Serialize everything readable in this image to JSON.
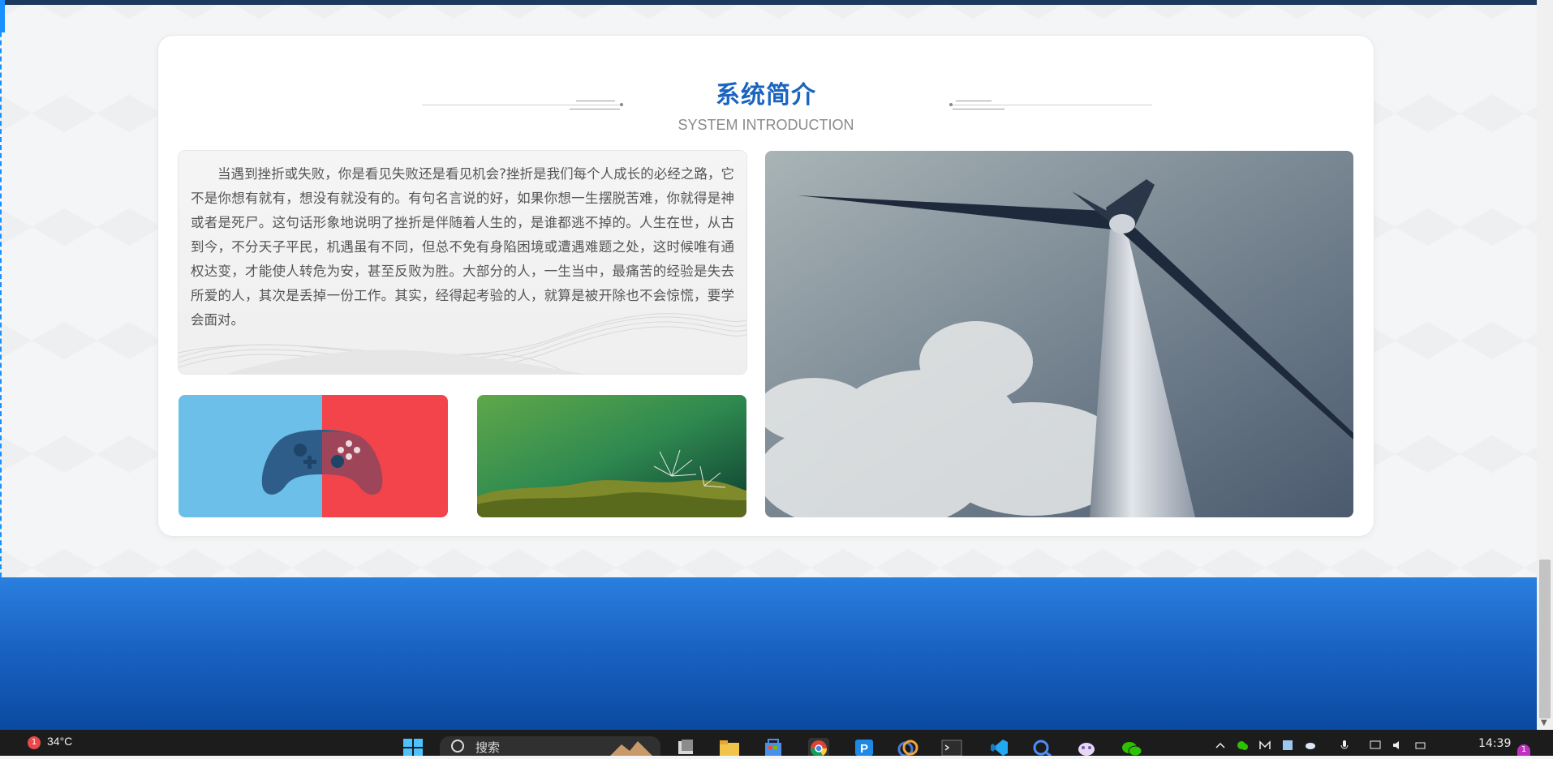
{
  "section": {
    "title": "系统简介",
    "subtitle": "SYSTEM INTRODUCTION"
  },
  "intro": {
    "text": "当遇到挫折或失败，你是看见失败还是看见机会?挫折是我们每个人成长的必经之路，它不是你想有就有，想没有就没有的。有句名言说的好，如果你想一生摆脱苦难，你就得是神或者是死尸。这句话形象地说明了挫折是伴随着人生的，是谁都逃不掉的。人生在世，从古到今，不分天子平民，机遇虽有不同，但总不免有身陷困境或遭遇难题之处，这时候唯有通权达变，才能使人转危为安，甚至反败为胜。大部分的人，一生当中，最痛苦的经验是失去所爱的人，其次是丢掉一份工作。其实，经得起考验的人，就算是被开除也不会惊慌，要学会面对。"
  },
  "images": {
    "gamepad": "gamepad-icon",
    "moss": "moss-dandelion-photo",
    "turbine": "wind-turbine-photo"
  },
  "taskbar": {
    "weather_temp": "34°C",
    "weather_badge": "1",
    "search_label": "搜索",
    "clock": "14:39",
    "notification_badge": "1"
  },
  "colors": {
    "title": "#1a64c0",
    "footer_top": "#2a7fdf",
    "footer_bottom": "#0a4aa0",
    "taskbar": "#1c1c1c"
  }
}
